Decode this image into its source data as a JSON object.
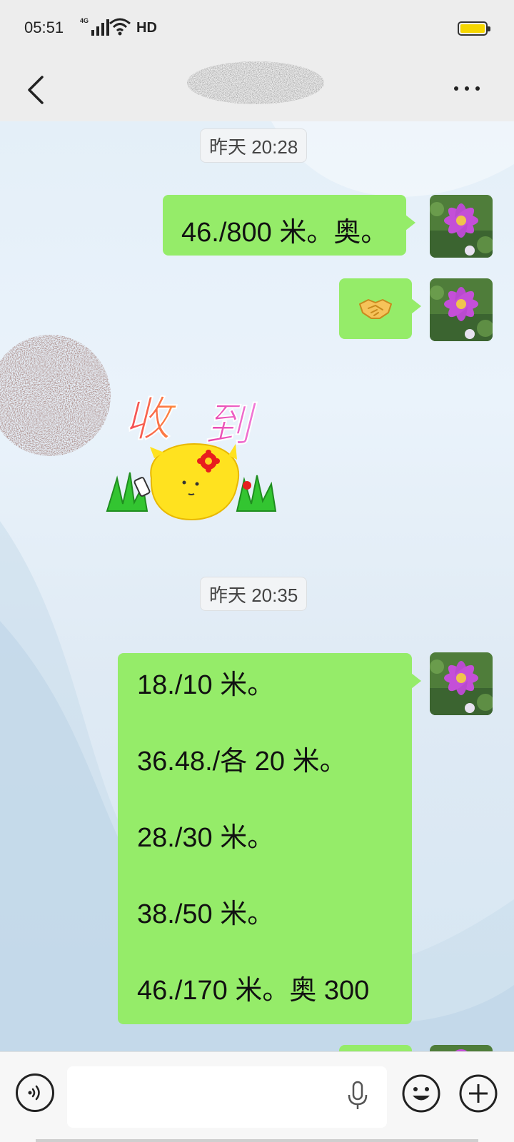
{
  "status_bar": {
    "time": "05:51",
    "network_tag": "4G",
    "network_label": "HD",
    "battery_color": "#f5d600"
  },
  "title_bar": {
    "back_icon": "chevron-left-icon",
    "more_icon": "more-dots-icon"
  },
  "chat": {
    "timestamps": [
      "昨天 20:28",
      "昨天 20:35"
    ],
    "messages": [
      {
        "type": "text",
        "lines": [
          "46./800 米。奥。"
        ]
      },
      {
        "type": "emoji",
        "emoji": "🤝"
      },
      {
        "type": "sticker",
        "text": "收到"
      },
      {
        "type": "text",
        "lines": [
          "18./10 米。",
          "36.48./各 20 米。",
          "28./30 米。",
          "38./50 米。",
          "46./170 米。奥 300"
        ]
      }
    ],
    "bubble_color": "#95ec69"
  },
  "input_bar": {
    "voice_icon": "voice-icon",
    "mic_icon": "microphone-icon",
    "emoji_icon": "smiley-icon",
    "plus_icon": "plus-icon",
    "value": ""
  }
}
